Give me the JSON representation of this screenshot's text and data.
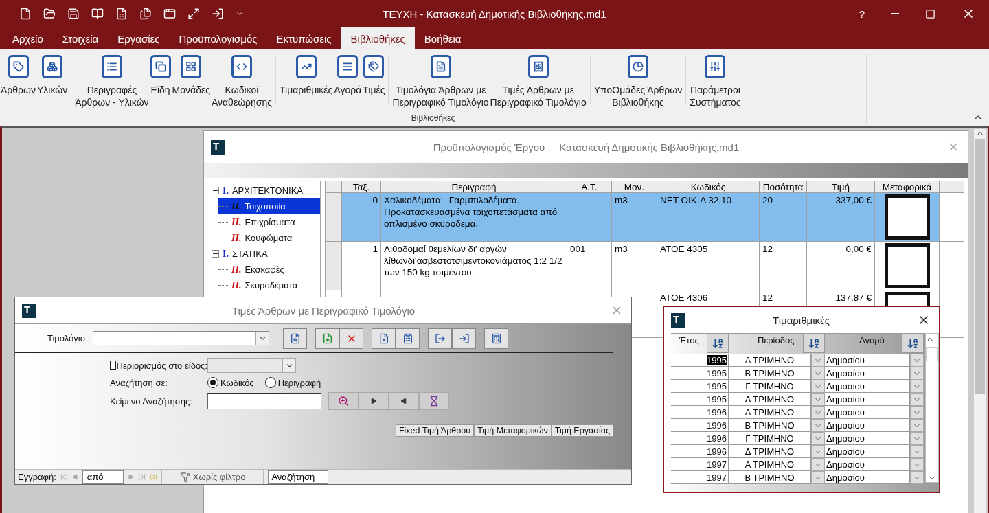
{
  "window": {
    "title": "ΤΕΥΧΗ - Κατασκευή Δημοτικής Βιβλιοθήκης.md1",
    "help": "?"
  },
  "menu_tabs": [
    {
      "label": "Αρχείο",
      "selected": false
    },
    {
      "label": "Στοιχεία",
      "selected": false
    },
    {
      "label": "Εργασίες",
      "selected": false
    },
    {
      "label": "Προϋπολογισμός",
      "selected": false
    },
    {
      "label": "Εκτυπώσεις",
      "selected": false
    },
    {
      "label": "Βιβλιοθήκες",
      "selected": true
    },
    {
      "label": "Βοήθεια",
      "selected": false
    }
  ],
  "ribbon": {
    "group_label": "Βιβλιοθήκες",
    "sections": [
      [
        {
          "label": "Άρθρων"
        },
        {
          "label": "Υλικών"
        }
      ],
      [
        {
          "label": "Περιγραφές\nΆρθρων - Υλικών"
        },
        {
          "label": "Είδη"
        },
        {
          "label": "Μονάδες"
        },
        {
          "label": "Κωδικοί\nΑναθεώρησης"
        }
      ],
      [
        {
          "label": "Τιμαριθμικές"
        },
        {
          "label": "Αγορά"
        },
        {
          "label": "Τιμές"
        }
      ],
      [
        {
          "label": "Τιμολόγια Άρθρων με\nΠεριγραφικό Τιμολόγιο"
        },
        {
          "label": "Τιμές Άρθρων με\nΠεριγραφικό Τιμολόγιο"
        }
      ],
      [
        {
          "label": "ΥποΟμάδες Άρθρων\nΒιβλιοθήκης"
        }
      ],
      [
        {
          "label": "Παράμετροι\nΣυστήματος"
        }
      ]
    ]
  },
  "document": {
    "logo": "T",
    "title": "Προϋπολογισμός Έργου :   Κατασκευή Δημοτικής Βιβλιοθήκης.md1",
    "tree": [
      {
        "numeral": "I.",
        "label": "ΑΡΧΙΤΕΚΤΟΝΙΚΑ",
        "expanded": true,
        "selected": false,
        "children": [
          {
            "numeral": "II.",
            "label": "Τοιχοποιία",
            "selected": true
          },
          {
            "numeral": "II.",
            "label": "Επιχρίσματα",
            "selected": false
          },
          {
            "numeral": "II.",
            "label": "Κουφώματα",
            "selected": false
          }
        ]
      },
      {
        "numeral": "I.",
        "label": "ΣΤΑΤΙΚΑ",
        "expanded": true,
        "selected": false,
        "children": [
          {
            "numeral": "II.",
            "label": "Εκσκαφές",
            "selected": false
          },
          {
            "numeral": "II.",
            "label": "Σκυροδέματα",
            "selected": false
          }
        ]
      }
    ],
    "table": {
      "columns": [
        "Ταξ.",
        "Περιγραφή",
        "Α.Τ.",
        "Μον.",
        "Κωδικός",
        "Ποσότητα",
        "Τιμή",
        "Μεταφορικά"
      ],
      "rows": [
        {
          "selected": true,
          "order": "0",
          "description": "Χαλικοδέματα - Γαρμπιλοδέματα. Προκατασκευασμένα τοιχοπετάσματα από οπλισμένο σκυρόδεμα.",
          "unit": "m3",
          "code": "ΝΕΤ ΟΙΚ-Α 32.10",
          "quantity": "20",
          "price": "337,00 €"
        },
        {
          "selected": false,
          "order": "1",
          "description": "Λιθοδομαί θεμελίων δι' αργών λίθωνδι'ασβεστοτσιμεντοκονιάματος 1:2 1/2 των 150 kg τσιμέντου.",
          "item_code": "001",
          "unit": "m3",
          "code": "ΑΤΟΕ 4305",
          "quantity": "12",
          "price": "0,00 €"
        },
        {
          "selected": false,
          "code": "ΑΤΟΕ 4306",
          "quantity": "12",
          "price": "137,87 €"
        }
      ]
    }
  },
  "invoice_dialog": {
    "logo": "T",
    "title": "Τιμές Άρθρων με Περιγραφικό Τιμολόγιο",
    "invoice_label": "Τιμολόγιο :",
    "restrict": {
      "label": "Περιορισμός στο είδος:",
      "checked": false
    },
    "search_in": {
      "label": "Αναζήτηση σε:",
      "options": [
        {
          "label": "Κωδικός",
          "selected": true
        },
        {
          "label": "Περιγραφή",
          "selected": false
        }
      ]
    },
    "search_text_label": "Κείμενο Αναζήτησης:",
    "columns": [
      "Fixed Τιμή Άρθρου",
      "Τιμή Μεταφορικών",
      "Τιμή Εργασίας"
    ],
    "navigator": {
      "label": "Εγγραφή:",
      "record": "από",
      "filter": "Χωρίς φίλτρο",
      "search": "Αναζήτηση"
    }
  },
  "index_dialog": {
    "logo": "T",
    "title": "Τιμαριθμικές",
    "columns": [
      "Έτος",
      "Περίοδος",
      "Αγορά"
    ],
    "rows": [
      {
        "year": "1995",
        "period": "Α ΤΡΙΜΗΝΟ",
        "market": "Δημοσίου",
        "selected": true
      },
      {
        "year": "1995",
        "period": "Β ΤΡΙΜΗΝΟ",
        "market": "Δημοσίου",
        "selected": false
      },
      {
        "year": "1995",
        "period": "Γ ΤΡΙΜΗΝΟ",
        "market": "Δημοσίου",
        "selected": false
      },
      {
        "year": "1995",
        "period": "Δ ΤΡΙΜΗΝΟ",
        "market": "Δημοσίου",
        "selected": false
      },
      {
        "year": "1996",
        "period": "Α ΤΡΙΜΗΝΟ",
        "market": "Δημοσίου",
        "selected": false
      },
      {
        "year": "1996",
        "period": "Β ΤΡΙΜΗΝΟ",
        "market": "Δημοσίου",
        "selected": false
      },
      {
        "year": "1996",
        "period": "Γ ΤΡΙΜΗΝΟ",
        "market": "Δημοσίου",
        "selected": false
      },
      {
        "year": "1996",
        "period": "Δ ΤΡΙΜΗΝΟ",
        "market": "Δημοσίου",
        "selected": false
      },
      {
        "year": "1997",
        "period": "Α ΤΡΙΜΗΝΟ",
        "market": "Δημοσίου",
        "selected": false
      },
      {
        "year": "1997",
        "period": "Β ΤΡΙΜΗΝΟ",
        "market": "Δημοσίου",
        "selected": false
      }
    ]
  }
}
